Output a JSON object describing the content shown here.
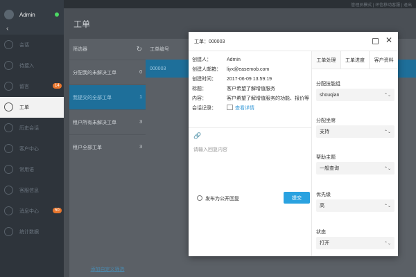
{
  "sidebar": {
    "user_name": "Admin",
    "back_glyph": "‹",
    "items": [
      {
        "label": "会话",
        "icon": "chat-icon"
      },
      {
        "label": "待接入",
        "icon": "queue-icon"
      },
      {
        "label": "留言",
        "icon": "message-icon",
        "badge": "14"
      },
      {
        "label": "工单",
        "icon": "ticket-icon",
        "active": true
      },
      {
        "label": "历史会话",
        "icon": "history-icon"
      },
      {
        "label": "客户中心",
        "icon": "customer-icon"
      },
      {
        "label": "常用语",
        "icon": "phrase-icon"
      },
      {
        "label": "客服信息",
        "icon": "agent-icon"
      },
      {
        "label": "消息中心",
        "icon": "notice-icon",
        "badge": "50"
      },
      {
        "label": "统计数据",
        "icon": "stats-icon"
      }
    ]
  },
  "header": {
    "top_links": "管理员模式 | 环信移动客服 | 退出"
  },
  "page": {
    "title": "工单"
  },
  "filter": {
    "title": "筛选器",
    "refresh_glyph": "↻",
    "items": [
      {
        "label": "分配我的未解决工单",
        "count": "0"
      },
      {
        "label": "我提交的全部工单",
        "count": "1",
        "selected": true
      },
      {
        "label": "租户所有未解决工单",
        "count": "3"
      },
      {
        "label": "租户全部工单",
        "count": "3"
      }
    ],
    "add_link": "添加自定义筛选"
  },
  "list": {
    "header": "工单编号",
    "row_id": "000003"
  },
  "modal": {
    "title": "工单：000003",
    "close_glyph": "✕",
    "info": [
      {
        "label": "创建人：",
        "value": "Admin"
      },
      {
        "label": "创建人邮箱：",
        "value": "liyx@easemob.com"
      },
      {
        "label": "创建时间：",
        "value": "2017-06-09 13:59:19"
      },
      {
        "label": "标题：",
        "value": "客户希望了解增值服务"
      },
      {
        "label": "内容：",
        "value": "客户希望了解增值服务的功能、报价等"
      }
    ],
    "chat_label": "会话记录：",
    "chat_link": "查看详情",
    "attach_glyph": "🔗",
    "reply_placeholder": "请输入回复内容",
    "public_reply_label": "发布为公开回复",
    "submit_label": "提交",
    "tabs": [
      "工单处理",
      "工单进度",
      "客户资料"
    ],
    "fields": [
      {
        "label": "分配技能组",
        "value": "shouqian"
      },
      {
        "label": "分配坐席",
        "value": "支持"
      },
      {
        "label": "帮助主题",
        "value": "一般查询"
      },
      {
        "label": "优先级",
        "value": "高"
      },
      {
        "label": "状态",
        "value": "打开"
      }
    ],
    "caret_glyph": "⌃⌄"
  }
}
